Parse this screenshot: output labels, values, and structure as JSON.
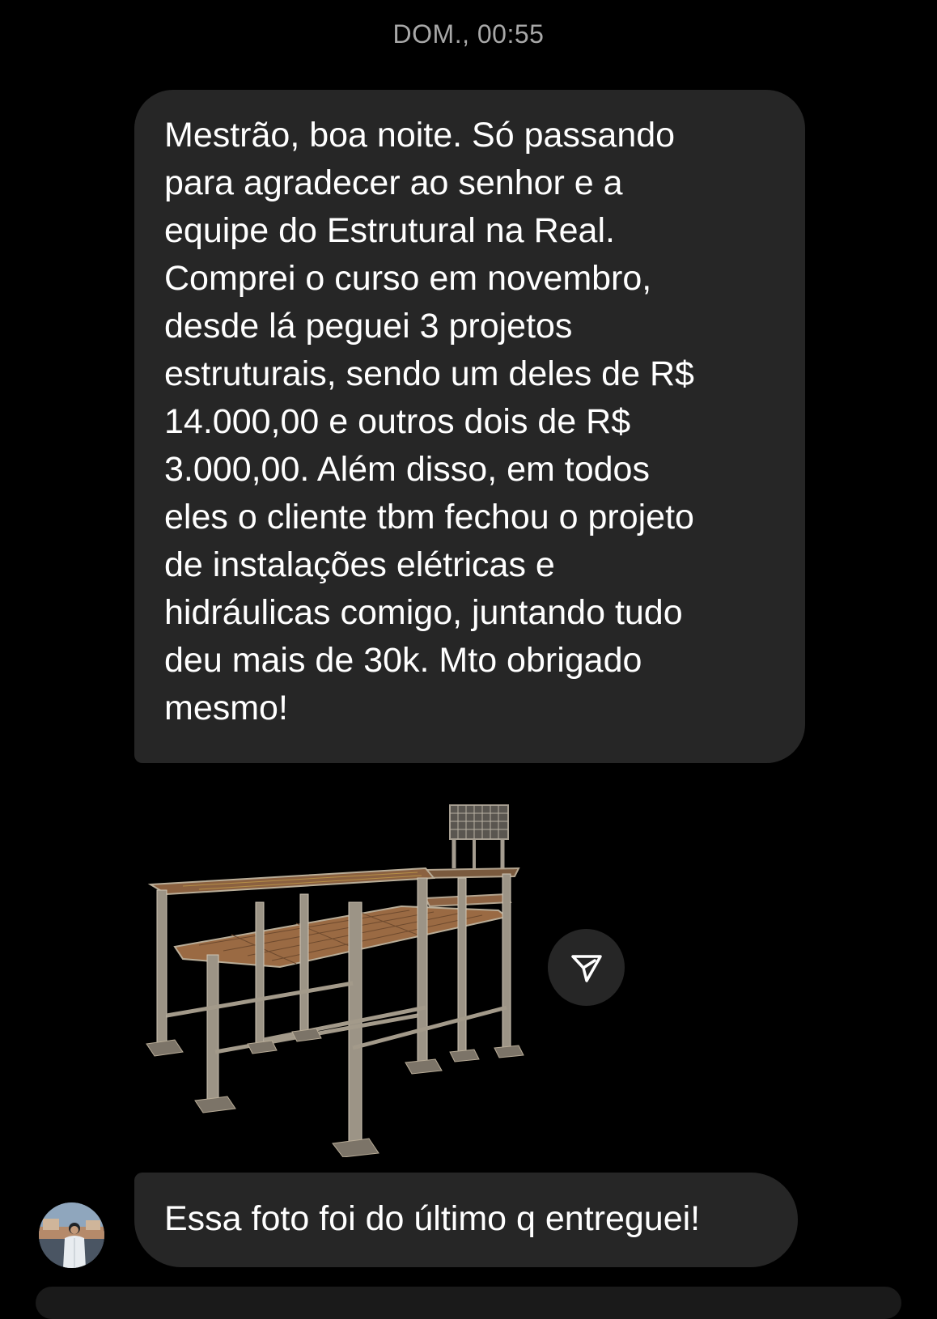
{
  "thread": {
    "timestamp": "DOM., 00:55"
  },
  "messages": [
    {
      "type": "text",
      "text": "Mestrão, boa noite. Só passando\npara agradecer ao senhor e a\nequipe do Estrutural na Real.\nComprei o curso em novembro,\ndesde lá peguei 3 projetos\nestruturais, sendo um deles de R$\n14.000,00 e outros dois de R$\n3.000,00. Além disso, em todos\neles o cliente tbm fechou o projeto\nde instalações elétricas e\nhidráulicas comigo, juntando tudo\ndeu mais de 30k. Mto obrigado\nmesmo!"
    },
    {
      "type": "image",
      "icon": "structural-3d-model-render"
    },
    {
      "type": "text",
      "text": "Essa foto foi do último q entreguei!"
    }
  ],
  "actions": {
    "share_icon": "paper-plane-icon"
  },
  "colors": {
    "background": "#000000",
    "bubble": "#262626",
    "timestamp": "#a8a8a8",
    "text": "#ffffff"
  }
}
